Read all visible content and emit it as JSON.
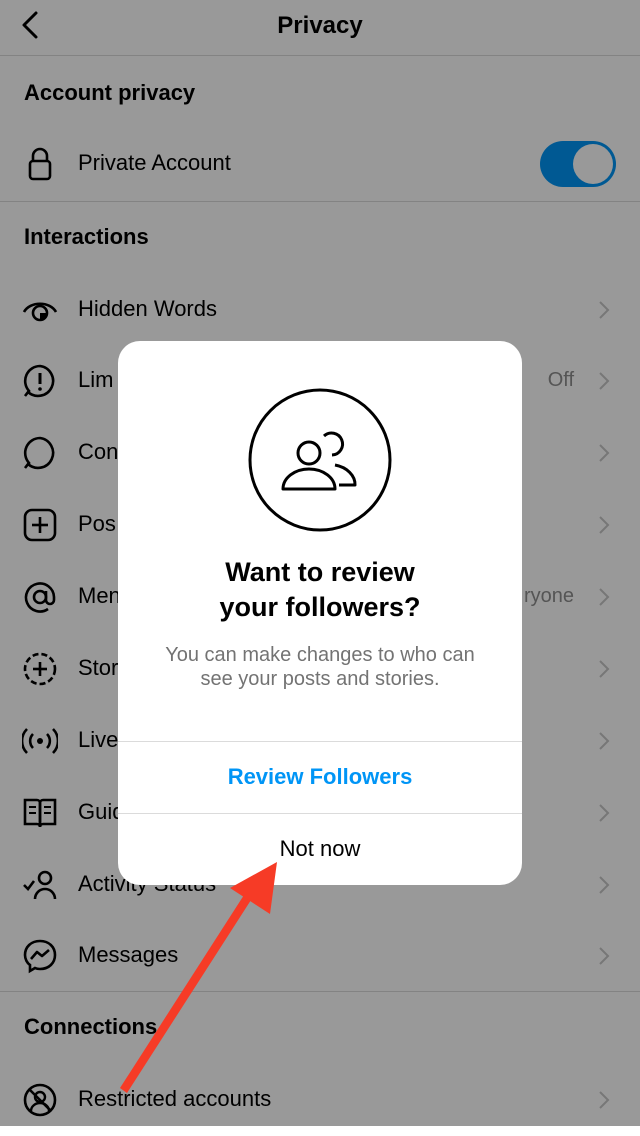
{
  "header": {
    "title": "Privacy",
    "back_icon": "chevron-left-icon"
  },
  "account_privacy": {
    "section_title": "Account privacy",
    "private_account": {
      "label": "Private Account",
      "icon": "lock-icon",
      "toggle_on": true
    }
  },
  "interactions": {
    "section_title": "Interactions",
    "items": [
      {
        "label": "Hidden Words",
        "value": "",
        "icon": "eye-icon"
      },
      {
        "label": "Lim",
        "value": "Off",
        "icon": "alert-bubble-icon"
      },
      {
        "label": "Con",
        "value": "",
        "icon": "comment-icon"
      },
      {
        "label": "Pos",
        "value": "",
        "icon": "plus-square-icon"
      },
      {
        "label": "Men",
        "value": "ryone",
        "icon": "at-icon"
      },
      {
        "label": "Stor",
        "value": "",
        "icon": "story-plus-icon"
      },
      {
        "label": "Live",
        "value": "",
        "icon": "live-icon"
      },
      {
        "label": "Guid",
        "value": "",
        "icon": "guide-icon"
      },
      {
        "label": "Activity Status",
        "value": "",
        "icon": "activity-status-icon"
      },
      {
        "label": "Messages",
        "value": "",
        "icon": "messenger-icon"
      }
    ]
  },
  "connections": {
    "section_title": "Connections",
    "items": [
      {
        "label": "Restricted accounts",
        "value": "",
        "icon": "restricted-icon"
      }
    ]
  },
  "modal": {
    "icon": "followers-icon",
    "title_line1": "Want to review",
    "title_line2": "your followers?",
    "body_line1": "You can make changes to who can",
    "body_line2": "see your posts and stories.",
    "primary_button": "Review Followers",
    "secondary_button": "Not now"
  },
  "annotation": {
    "arrow_color": "#f63b26"
  },
  "colors": {
    "accent": "#0095f6",
    "secondary_text": "#8e8e8e"
  }
}
